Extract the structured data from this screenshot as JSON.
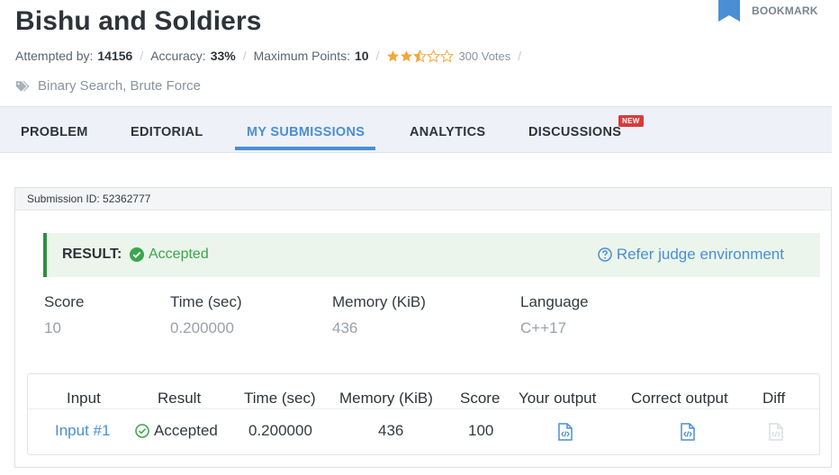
{
  "problem": {
    "title": "Bishu and Soldiers",
    "attempted_label": "Attempted by:",
    "attempted_value": "14156",
    "accuracy_label": "Accuracy:",
    "accuracy_value": "33%",
    "max_points_label": "Maximum Points:",
    "max_points_value": "10",
    "rating": 2.5,
    "votes": "300 Votes",
    "tags": "Binary Search, Brute Force"
  },
  "bookmark": {
    "label": "BOOKMARK",
    "icon": "bookmark-icon"
  },
  "tabs": [
    {
      "label": "PROBLEM",
      "active": false
    },
    {
      "label": "EDITORIAL",
      "active": false
    },
    {
      "label": "MY SUBMISSIONS",
      "active": true
    },
    {
      "label": "ANALYTICS",
      "active": false
    },
    {
      "label": "DISCUSSIONS",
      "active": false,
      "badge": "NEW"
    }
  ],
  "submission": {
    "id_text": "Submission ID: 52362777",
    "result_label": "RESULT:",
    "result_value": "Accepted",
    "judge_link": "Refer judge environment",
    "stats": [
      {
        "label": "Score",
        "value": "10"
      },
      {
        "label": "Time (sec)",
        "value": "0.200000"
      },
      {
        "label": "Memory (KiB)",
        "value": "436"
      },
      {
        "label": "Language",
        "value": "C++17"
      }
    ]
  },
  "results_table": {
    "headers": [
      "Input",
      "Result",
      "Time (sec)",
      "Memory (KiB)",
      "Score",
      "Your output",
      "Correct output",
      "Diff"
    ],
    "rows": [
      {
        "input": "Input #1",
        "result": "Accepted",
        "time": "0.200000",
        "memory": "436",
        "score": "100"
      }
    ]
  },
  "colors": {
    "accent": "#4a8fd4",
    "success": "#3aa64a",
    "success_border": "#2f8f3f",
    "star": "#f0a83a",
    "badge": "#d93a3a"
  }
}
